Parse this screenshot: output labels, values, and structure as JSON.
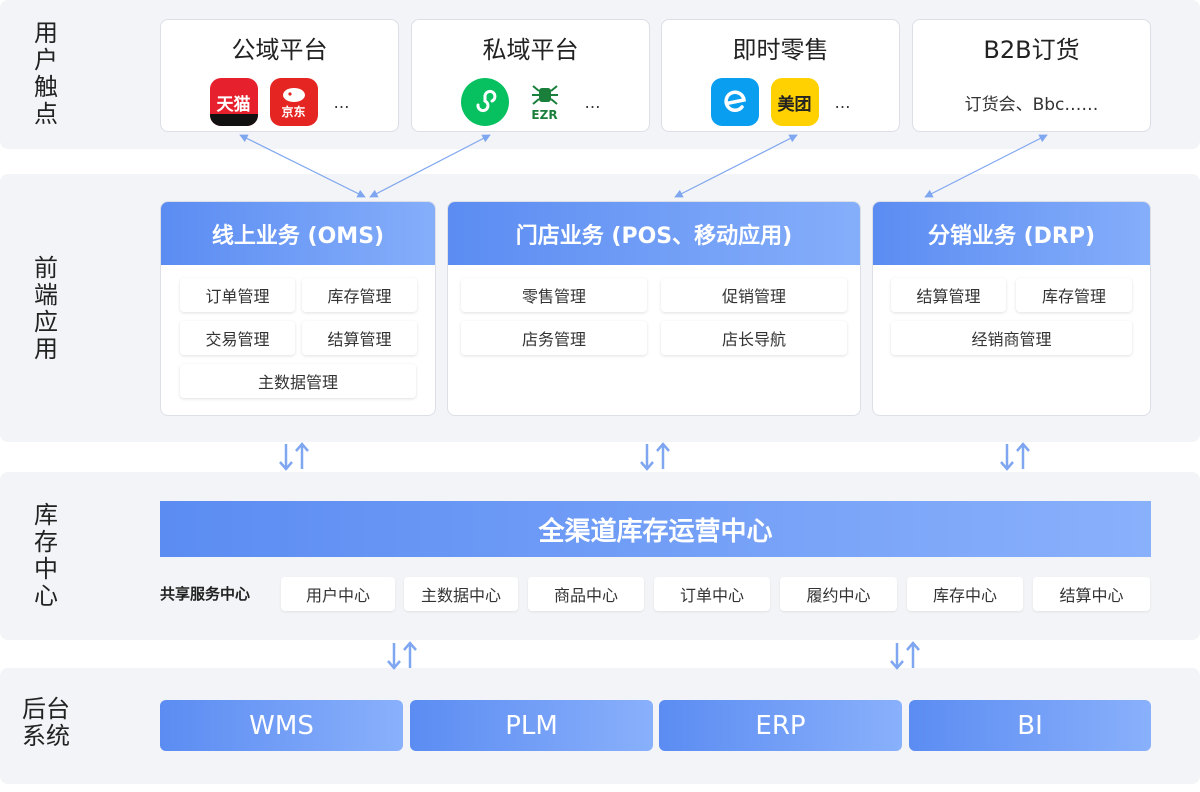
{
  "layers": {
    "touch": [
      "用",
      "户",
      "触",
      "点"
    ],
    "frontend": [
      "前",
      "端",
      "应",
      "用"
    ],
    "inventory": [
      "库",
      "存",
      "中",
      "心"
    ],
    "backend": [
      "后台",
      "系统"
    ]
  },
  "touchpoints": [
    {
      "title": "公域平台",
      "icons": [
        {
          "name": "tmall-icon",
          "label": "天猫",
          "color": "#e6212d"
        },
        {
          "name": "jd-icon",
          "label": "京东",
          "color": "#e52521"
        }
      ],
      "more": "…"
    },
    {
      "title": "私域平台",
      "icons": [
        {
          "name": "mini-program-icon",
          "label": "",
          "color": "#07c160"
        },
        {
          "name": "ezr-icon",
          "label": "EZR",
          "color": "#1a7f3a"
        }
      ],
      "more": "…"
    },
    {
      "title": "即时零售",
      "icons": [
        {
          "name": "eleme-icon",
          "label": "",
          "color": "#0a9ef0"
        },
        {
          "name": "meituan-icon",
          "label": "美团",
          "color": "#ffd100"
        }
      ],
      "more": "…"
    },
    {
      "title": "B2B订货",
      "text": "订货会、Bbc……"
    }
  ],
  "frontend_apps": [
    {
      "title": "线上业务 (OMS)",
      "modules": [
        "订单管理",
        "库存管理",
        "交易管理",
        "结算管理",
        "主数据管理"
      ]
    },
    {
      "title": "门店业务 (POS、移动应用)",
      "modules": [
        "零售管理",
        "促销管理",
        "店务管理",
        "店长导航"
      ]
    },
    {
      "title": "分销业务 (DRP)",
      "modules": [
        "结算管理",
        "库存管理",
        "经销商管理"
      ]
    }
  ],
  "inventory_center": {
    "title": "全渠道库存运营中心",
    "shared_label": "共享服务中心",
    "services": [
      "用户中心",
      "主数据中心",
      "商品中心",
      "订单中心",
      "履约中心",
      "库存中心",
      "结算中心"
    ]
  },
  "backend_systems": [
    "WMS",
    "PLM",
    "ERP",
    "BI"
  ],
  "colors": {
    "accent": "#5b8cf2",
    "accent_light": "#89b0fb",
    "arrow": "#7fa6f0",
    "band": "#f3f4f7"
  }
}
